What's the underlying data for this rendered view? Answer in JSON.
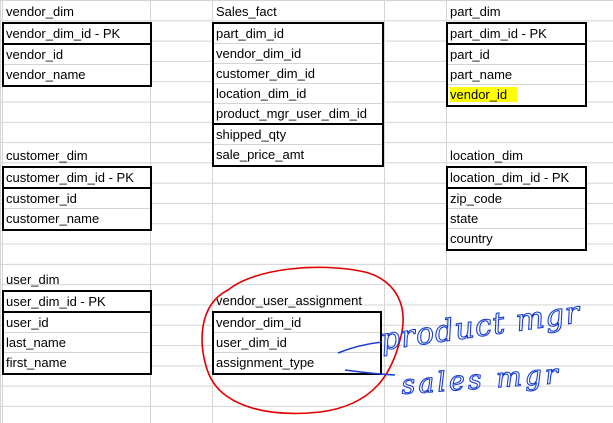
{
  "tables": {
    "vendor_dim": {
      "title": "vendor_dim",
      "pk": "vendor_dim_id - PK",
      "fields": [
        "vendor_id",
        "vendor_name"
      ]
    },
    "sales_fact": {
      "title": "Sales_fact",
      "fields": [
        "part_dim_id",
        "vendor_dim_id",
        "customer_dim_id",
        "location_dim_id",
        "product_mgr_user_dim_id"
      ],
      "measures": [
        "shipped_qty",
        "sale_price_amt"
      ]
    },
    "part_dim": {
      "title": "part_dim",
      "pk": "part_dim_id - PK",
      "fields": [
        "part_id",
        "part_name",
        "vendor_id"
      ]
    },
    "customer_dim": {
      "title": "customer_dim",
      "pk": "customer_dim_id - PK",
      "fields": [
        "customer_id",
        "customer_name"
      ]
    },
    "location_dim": {
      "title": "location_dim",
      "pk": "location_dim_id - PK",
      "fields": [
        "zip_code",
        "state",
        "country"
      ]
    },
    "user_dim": {
      "title": "user_dim",
      "pk": "user_dim_id - PK",
      "fields": [
        "user_id",
        "last_name",
        "first_name"
      ]
    },
    "vendor_user_assignment": {
      "title": "vendor_user_assignment",
      "fields": [
        "vendor_dim_id",
        "user_dim_id",
        "assignment_type"
      ]
    }
  },
  "annotations": {
    "line1": "product mgr",
    "line2": "sales mgr"
  },
  "colors": {
    "highlight": "#ffff00",
    "red_ink": "#e00000",
    "blue_ink": "#1a3fd0"
  }
}
